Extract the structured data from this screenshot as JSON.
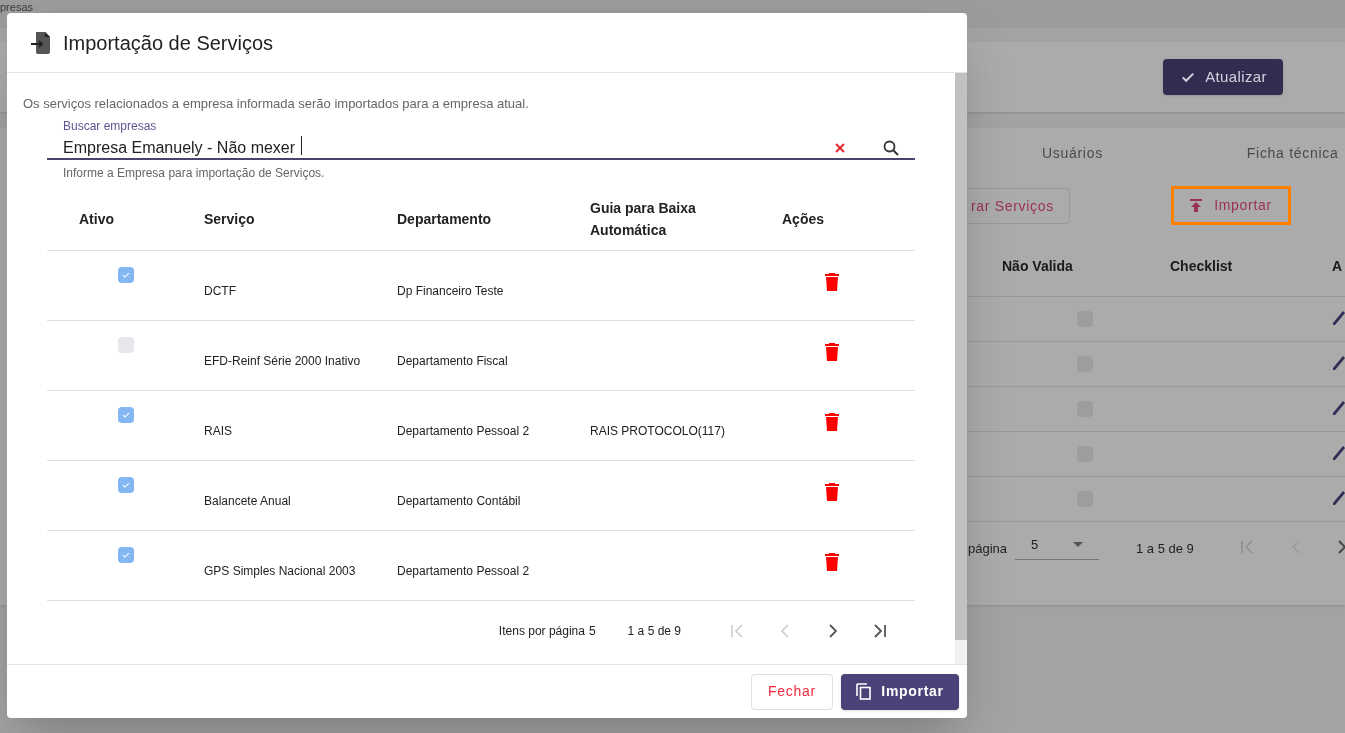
{
  "background": {
    "breadcrumb": "presas",
    "update_button": "Atualizar",
    "tabs": [
      {
        "label": "Usuários"
      },
      {
        "label": "Ficha técnica"
      }
    ],
    "buttons": [
      {
        "kind": "outline",
        "label": "rar Serviços"
      },
      {
        "kind": "import",
        "label": "Importar"
      }
    ],
    "table": {
      "columns": [
        "Não Valida",
        "Checklist",
        "A"
      ],
      "rows": [
        {
          "nao_valida": false
        },
        {
          "nao_valida": false
        },
        {
          "nao_valida": false
        },
        {
          "nao_valida": false
        },
        {
          "nao_valida": false
        }
      ]
    },
    "pagination": {
      "label": "página",
      "page_size": "5",
      "range": "1 a 5 de 9"
    }
  },
  "dialog": {
    "title": "Importação de Serviços",
    "description": "Os serviços relacionados a empresa informada serão importados para a empresa atual.",
    "search": {
      "label": "Buscar empresas",
      "value": "Empresa Emanuely - Não mexer",
      "hint": "Informe a Empresa para importação de Serviços."
    },
    "table": {
      "columns": [
        "Ativo",
        "Serviço",
        "Departamento",
        "Guia para Baixa Automática",
        "Ações"
      ],
      "rows": [
        {
          "ativo": true,
          "servico": "DCTF",
          "departamento": "Dp Financeiro Teste"
        },
        {
          "ativo": false,
          "servico": "EFD-Reinf Série 2000 Inativo",
          "departamento": "Departamento Fiscal"
        },
        {
          "ativo": true,
          "servico": "RAIS",
          "departamento": "Departamento Pessoal 2",
          "guia": "RAIS PROTOCOLO(117)"
        },
        {
          "ativo": true,
          "servico": "Balancete Anual",
          "departamento": "Departamento Contábil"
        },
        {
          "ativo": true,
          "servico": "GPS Simples Nacional 2003",
          "departamento": "Departamento Pessoal 2"
        }
      ]
    },
    "pagination": {
      "label": "Itens por página",
      "page_size": "5",
      "range": "1 a 5 de 9"
    },
    "buttons": [
      {
        "kind": "close",
        "label": "Fechar"
      },
      {
        "kind": "primary",
        "label": "Importar"
      }
    ]
  }
}
